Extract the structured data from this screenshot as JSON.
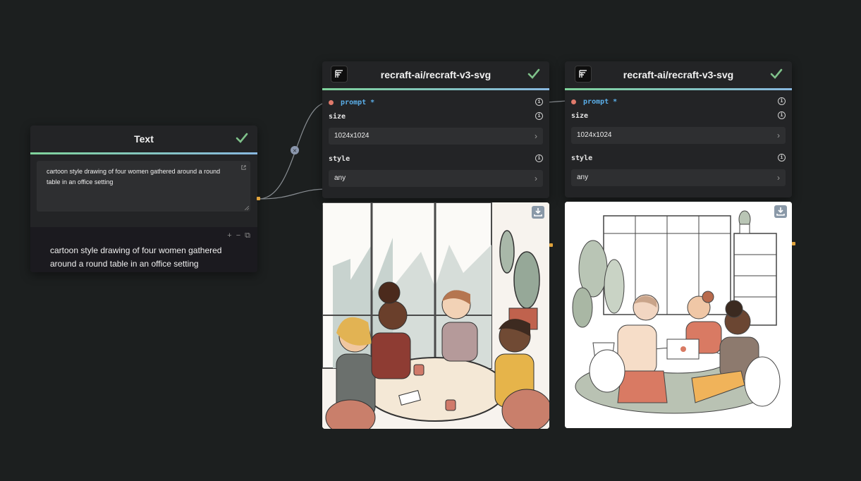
{
  "colors": {
    "background": "#1c1f1f",
    "node": "#232426",
    "accent_green": "#7fd39b",
    "accent_blue": "#88b8e0",
    "required_dot": "#e07a6b",
    "prompt_label": "#5aaee8",
    "port": "#e0a33c"
  },
  "text_node": {
    "title": "Text",
    "textarea_value": "cartoon style drawing of four women gathered around a round table in an office setting",
    "output_text": "cartoon style drawing of four women gathered around a round table in an office setting",
    "status_icon": "check-icon",
    "open_icon": "external-link-icon",
    "toolbar_icons": [
      "plus-icon",
      "minus-icon",
      "copy-icon"
    ]
  },
  "gen_nodes": [
    {
      "title": "recraft-ai/recraft-v3-svg",
      "prompt_label": "prompt *",
      "size_label": "size",
      "size_value": "1024x1024",
      "style_label": "style",
      "style_value": "any",
      "status_icon": "check-icon",
      "image_alt": "Cartoon of four women at a round office table near a window with a plant"
    },
    {
      "title": "recraft-ai/recraft-v3-svg",
      "prompt_label": "prompt *",
      "size_label": "size",
      "size_value": "1024x1024",
      "style_label": "style",
      "style_value": "any",
      "status_icon": "check-icon",
      "image_alt": "Line-art of four women around a table with a laptop, bookshelf and plants"
    }
  ]
}
